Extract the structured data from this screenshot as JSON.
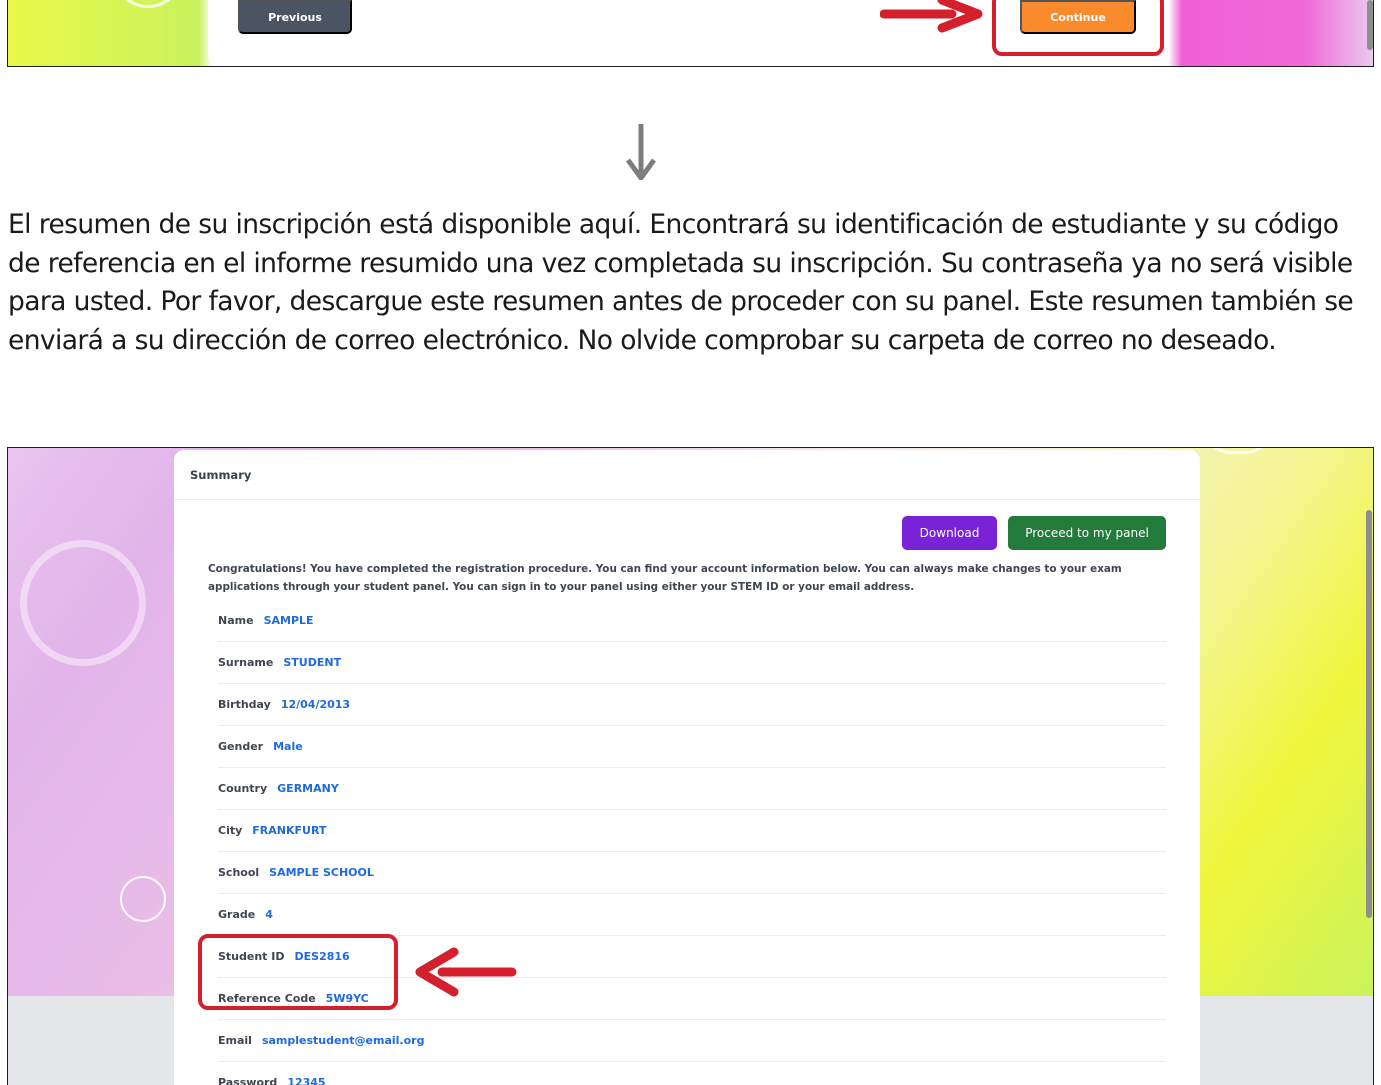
{
  "top_strip": {
    "previous_label": "Previous",
    "continue_label": "Continue"
  },
  "instructions_text": "El resumen de su inscripción está disponible aquí. Encontrará su identificación de estudiante y su código de referencia en el informe resumido una vez completada su inscripción. Su contraseña ya no será visible para usted. Por favor, descargue este resumen antes de proceder con su panel. Este resumen también se enviará a su dirección de correo electrónico. No olvide comprobar su carpeta de correo no deseado.",
  "summary": {
    "title": "Summary",
    "download_label": "Download",
    "proceed_label": "Proceed to my panel",
    "congrats_text": "Congratulations! You have completed the registration procedure. You can find your account information below. You can always make changes to your exam applications through your student panel. You can sign in to your panel using either your STEM ID or your email address.",
    "fields": [
      {
        "label": "Name",
        "value": "SAMPLE"
      },
      {
        "label": "Surname",
        "value": "STUDENT"
      },
      {
        "label": "Birthday",
        "value": "12/04/2013"
      },
      {
        "label": "Gender",
        "value": "Male"
      },
      {
        "label": "Country",
        "value": "GERMANY"
      },
      {
        "label": "City",
        "value": "FRANKFURT"
      },
      {
        "label": "School",
        "value": "SAMPLE SCHOOL"
      },
      {
        "label": "Grade",
        "value": "4"
      },
      {
        "label": "Student ID",
        "value": "DES2816"
      },
      {
        "label": "Reference Code",
        "value": "5W9YC"
      },
      {
        "label": "Email",
        "value": "samplestudent@email.org"
      },
      {
        "label": "Password",
        "value": "12345"
      }
    ]
  },
  "colors": {
    "annotation_red": "#d3202c",
    "download_purple": "#7a22d8",
    "proceed_green": "#227a3b",
    "continue_orange": "#f98b2c",
    "value_blue": "#1f6ae0"
  },
  "icons": {
    "down_arrow": "arrow-down-icon",
    "annotation_arrow": "red-arrow-icon"
  }
}
